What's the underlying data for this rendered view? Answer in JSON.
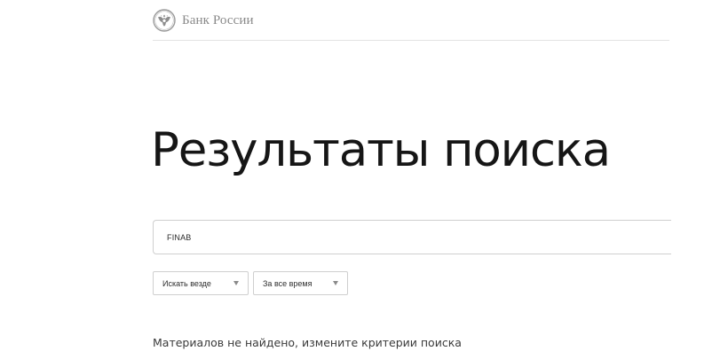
{
  "header": {
    "logo_text": "Банк России",
    "logo_icon": "double-headed-eagle-emblem-icon"
  },
  "main": {
    "title": "Результаты поиска",
    "search": {
      "value": "FINAB",
      "placeholder": ""
    },
    "filters": [
      {
        "label": "Искать везде",
        "icon": "caret-down-icon"
      },
      {
        "label": "За все время",
        "icon": "caret-down-icon"
      }
    ],
    "empty_message": "Материалов не найдено, измените критерии поиска"
  },
  "colors": {
    "text": "#161616",
    "muted": "#8a8a8a",
    "border": "#cfcfcf",
    "divider": "#e3e3e3",
    "background": "#ffffff"
  }
}
